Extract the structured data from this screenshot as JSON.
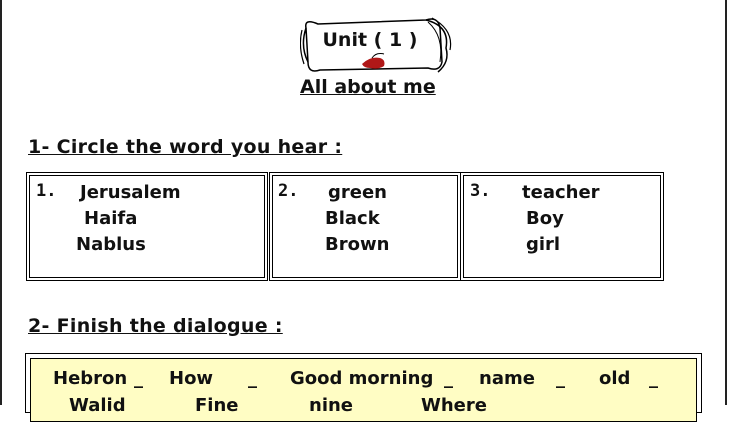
{
  "header": {
    "unit_title": "Unit ( 1 )",
    "main_heading": "All about me"
  },
  "section1": {
    "title": "1- Circle the word you hear :",
    "groups": [
      {
        "number": "1.",
        "words": [
          "Jerusalem",
          "Haifa",
          "Nablus"
        ]
      },
      {
        "number": "2.",
        "words": [
          "green",
          "Black",
          "Brown"
        ]
      },
      {
        "number": "3.",
        "words": [
          "teacher",
          "Boy",
          "girl"
        ]
      }
    ]
  },
  "section2": {
    "title": "2- Finish the dialogue :",
    "word_bank": {
      "row1": [
        "Hebron",
        "How",
        "Good morning",
        "name",
        "old"
      ],
      "row2": [
        "Walid",
        "Fine",
        "nine",
        "Where"
      ],
      "separator": "_"
    }
  },
  "colors": {
    "word_bank_background": "#fffdc4",
    "blood_mark": "#b01818"
  }
}
